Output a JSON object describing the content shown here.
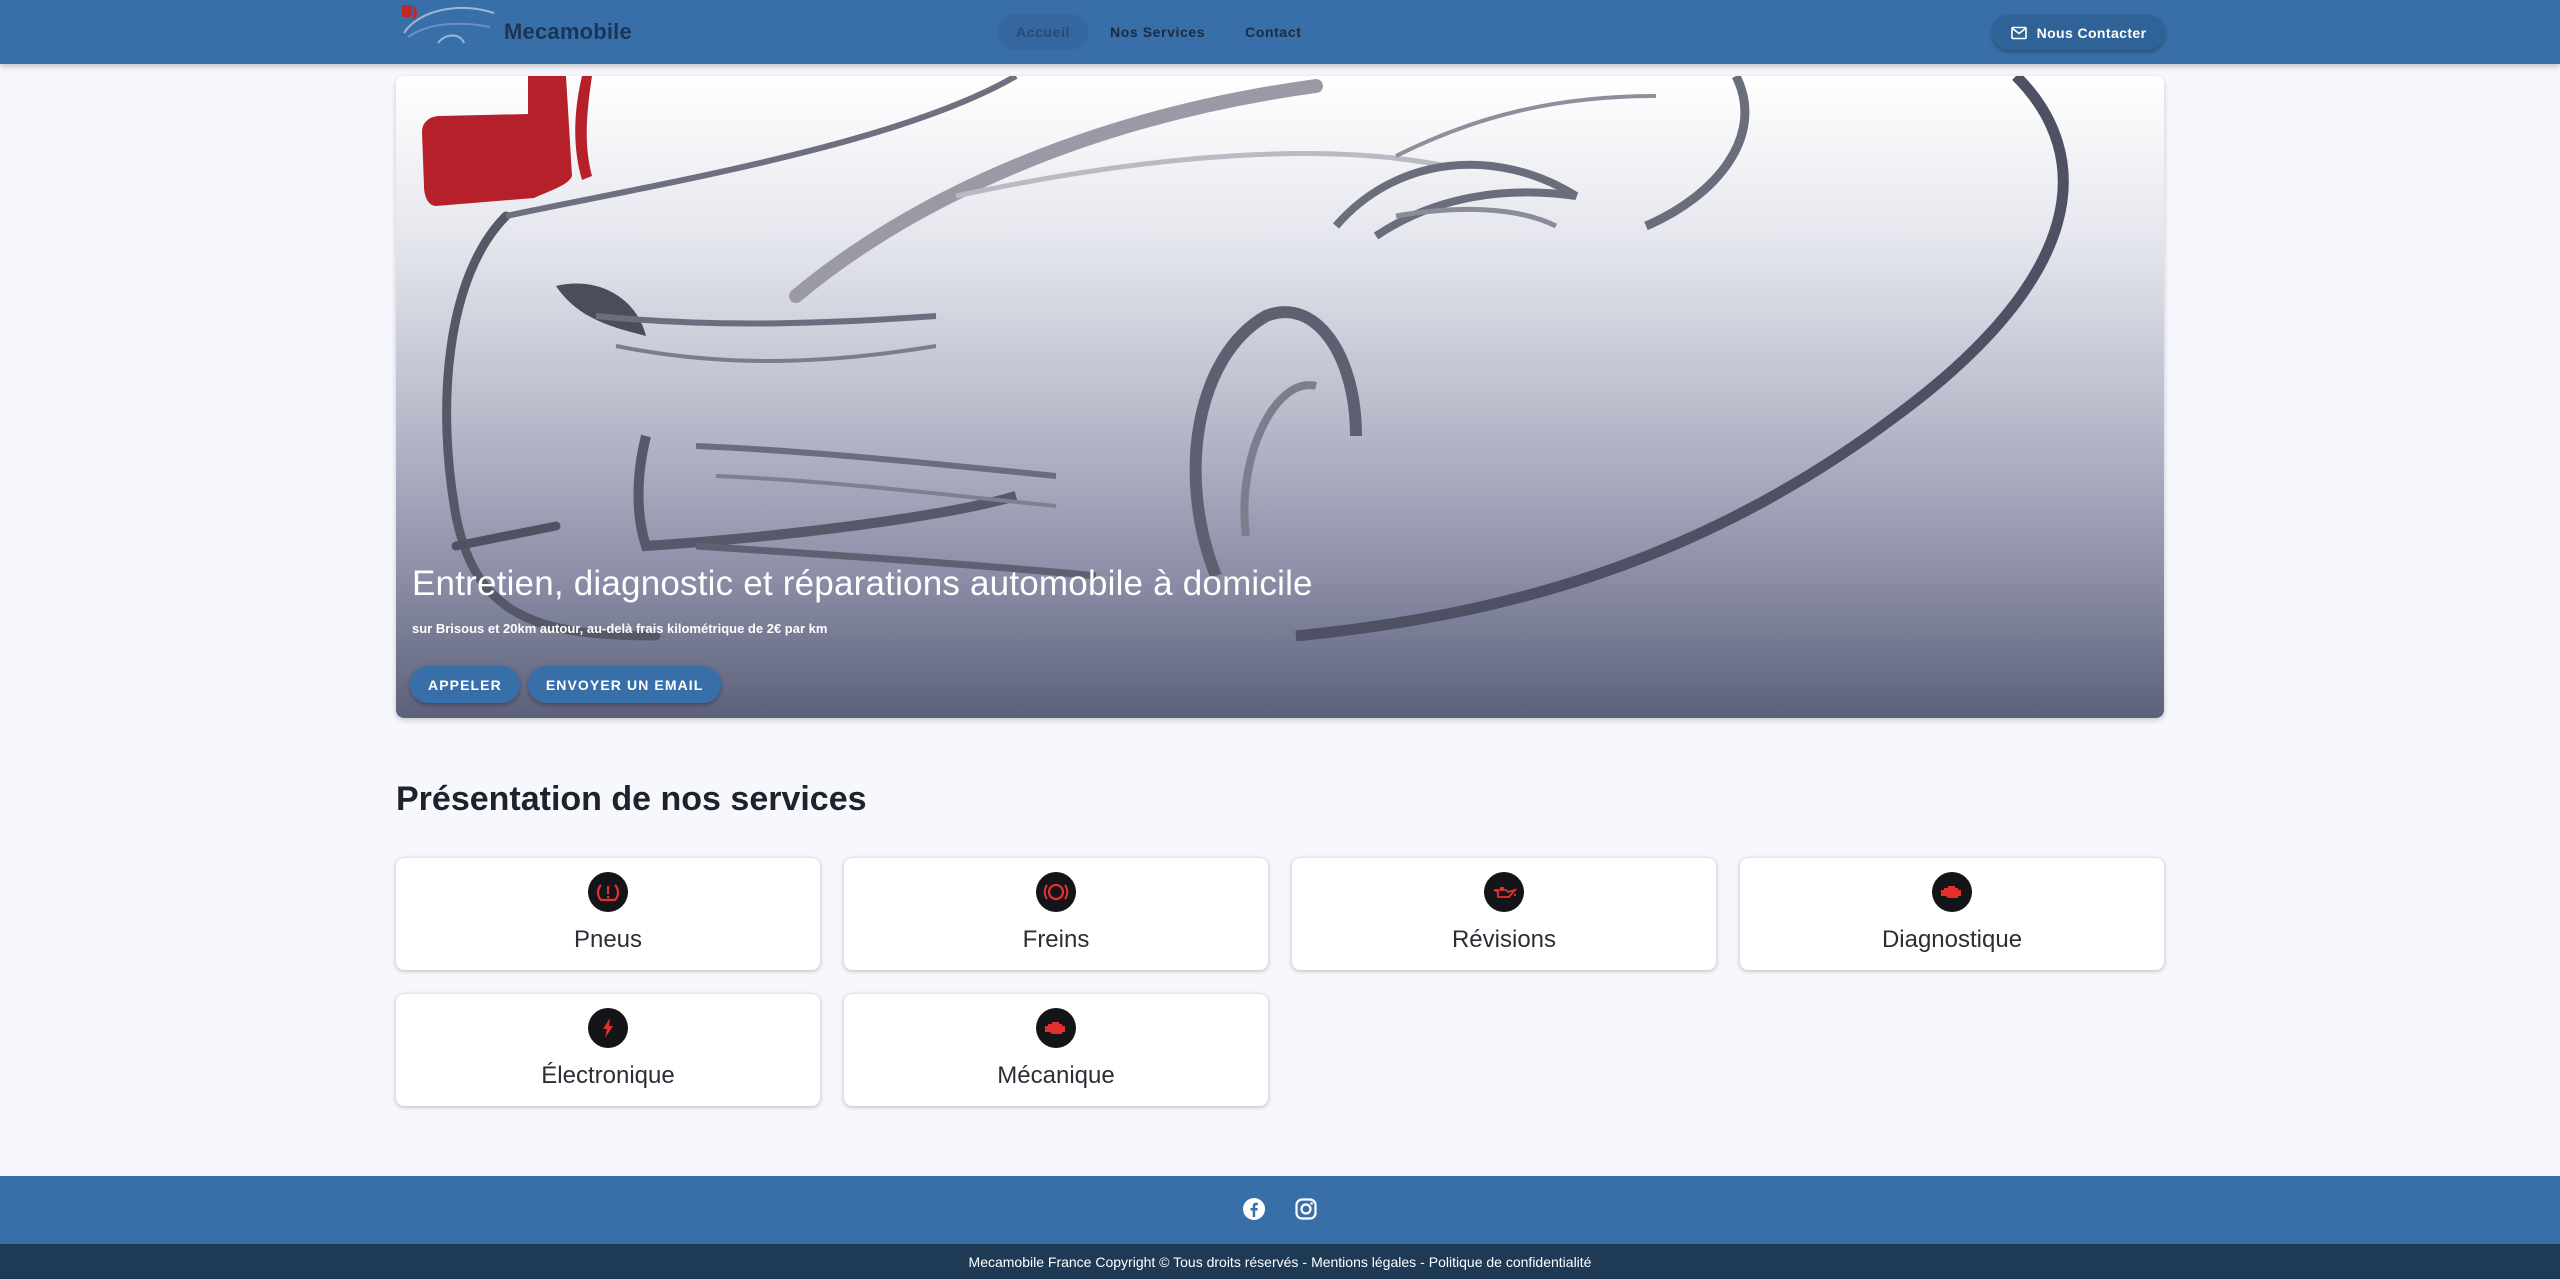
{
  "header": {
    "brand": "Mecamobile",
    "nav": [
      {
        "label": "Accueil"
      },
      {
        "label": "Nos Services"
      },
      {
        "label": "Contact"
      }
    ],
    "contact_button": "Nous Contacter"
  },
  "hero": {
    "title": "Entretien, diagnostic et réparations automobile à domicile",
    "subtitle": "sur Brisous et 20km autour, au-delà frais kilométrique de 2€ par km",
    "buttons": [
      {
        "label": "APPELER"
      },
      {
        "label": "ENVOYER UN EMAIL"
      }
    ]
  },
  "services": {
    "title": "Présentation de nos services",
    "items": [
      {
        "label": "Pneus",
        "icon": "tire-pressure-icon"
      },
      {
        "label": "Freins",
        "icon": "brake-warning-icon"
      },
      {
        "label": "Révisions",
        "icon": "oil-can-icon"
      },
      {
        "label": "Diagnostique",
        "icon": "engine-icon"
      },
      {
        "label": "Électronique",
        "icon": "lightning-icon"
      },
      {
        "label": "Mécanique",
        "icon": "engine-icon"
      }
    ]
  },
  "footer": {
    "copyright": "Mecamobile France Copyright © Tous droits réservés",
    "separator": "-",
    "legal": "Mentions légales",
    "privacy": "Politique de confidentialité",
    "social": [
      "facebook-icon",
      "instagram-icon"
    ]
  },
  "colors": {
    "header_bg": "#386fa9",
    "footer_bottom_bg": "#1f3a55",
    "accent_red": "#e02020",
    "page_bg": "#f6f8fd"
  }
}
